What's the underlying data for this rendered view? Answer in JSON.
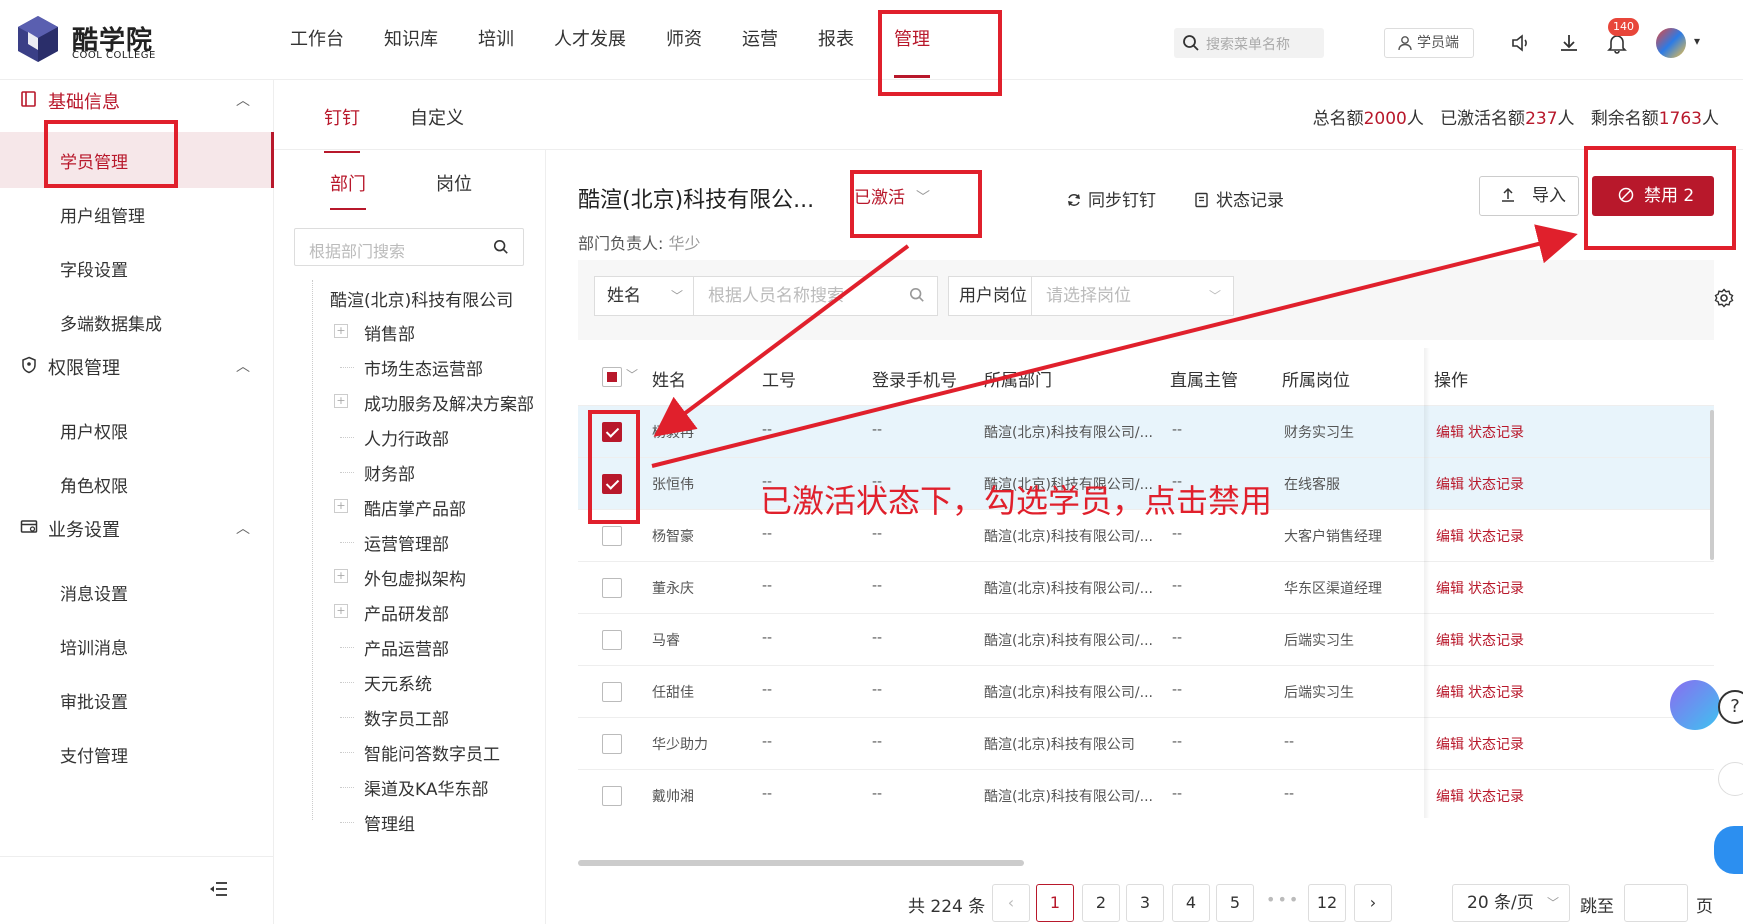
{
  "brand": {
    "name": "酷学院",
    "sub": "COOL COLLEGE"
  },
  "nav": [
    "工作台",
    "知识库",
    "培训",
    "人才发展",
    "师资",
    "运营",
    "报表",
    "管理"
  ],
  "header": {
    "search_placeholder": "搜索菜单名称",
    "student_label": "学员端",
    "notification_count": "140"
  },
  "sidebar": {
    "groups": [
      {
        "label": "基础信息",
        "items": [
          "学员管理",
          "用户组管理",
          "字段设置",
          "多端数据集成"
        ]
      },
      {
        "label": "权限管理",
        "items": [
          "用户权限",
          "角色权限"
        ]
      },
      {
        "label": "业务设置",
        "items": [
          "消息设置",
          "培训消息",
          "审批设置",
          "支付管理"
        ]
      }
    ]
  },
  "main_tabs": [
    "钉钉",
    "自定义"
  ],
  "quota": {
    "total_label": "总名额",
    "total": "2000",
    "unit": "人",
    "active_label": "已激活名额",
    "active": "237",
    "remaining_label": "剩余名额",
    "remaining": "1763"
  },
  "dept_tabs": [
    "部门",
    "岗位"
  ],
  "dept_search_placeholder": "根据部门搜索",
  "tree": {
    "root": "酷渲(北京)科技有限公司",
    "nodes": [
      {
        "label": "销售部",
        "expandable": true
      },
      {
        "label": "市场生态运营部",
        "expandable": false
      },
      {
        "label": "成功服务及解决方案部",
        "expandable": true
      },
      {
        "label": "人力行政部",
        "expandable": false
      },
      {
        "label": "财务部",
        "expandable": false
      },
      {
        "label": "酷店掌产品部",
        "expandable": true
      },
      {
        "label": "运营管理部",
        "expandable": false
      },
      {
        "label": "外包虚拟架构",
        "expandable": true
      },
      {
        "label": "产品研发部",
        "expandable": true
      },
      {
        "label": "产品运营部",
        "expandable": false
      },
      {
        "label": "天元系统",
        "expandable": false
      },
      {
        "label": "数字员工部",
        "expandable": false
      },
      {
        "label": "智能问答数字员工",
        "expandable": false
      },
      {
        "label": "渠道及KA华东部",
        "expandable": false
      },
      {
        "label": "管理组",
        "expandable": false
      }
    ]
  },
  "content": {
    "company": "酷渲(北京)科技有限公...",
    "status": "已激活",
    "dept_head_label": "部门负责人:",
    "dept_head": "华少",
    "sync_label": "同步钉钉",
    "status_log_label": "状态记录",
    "import_label": "导入",
    "ban_label": "禁用 2"
  },
  "filters": {
    "name_select": "姓名",
    "name_placeholder": "根据人员名称搜索",
    "post_label": "用户岗位",
    "post_placeholder": "请选择岗位"
  },
  "table": {
    "headers": [
      "姓名",
      "工号",
      "登录手机号",
      "所属部门",
      "直属主管",
      "所属岗位",
      "操作"
    ],
    "rows": [
      {
        "name": "杨毅冉",
        "id": "--",
        "phone": "--",
        "dept": "酷渲(北京)科技有限公司/...",
        "manager": "--",
        "post": "财务实习生",
        "checked": true
      },
      {
        "name": "张恒伟",
        "id": "--",
        "phone": "--",
        "dept": "酷渲(北京)科技有限公司/...",
        "manager": "--",
        "post": "在线客服",
        "checked": true
      },
      {
        "name": "杨智豪",
        "id": "--",
        "phone": "--",
        "dept": "酷渲(北京)科技有限公司/...",
        "manager": "--",
        "post": "大客户销售经理",
        "checked": false
      },
      {
        "name": "董永庆",
        "id": "--",
        "phone": "--",
        "dept": "酷渲(北京)科技有限公司/...",
        "manager": "--",
        "post": "华东区渠道经理",
        "checked": false
      },
      {
        "name": "马睿",
        "id": "--",
        "phone": "--",
        "dept": "酷渲(北京)科技有限公司/...",
        "manager": "--",
        "post": "后端实习生",
        "checked": false
      },
      {
        "name": "任甜佳",
        "id": "--",
        "phone": "--",
        "dept": "酷渲(北京)科技有限公司/...",
        "manager": "--",
        "post": "后端实习生",
        "checked": false
      },
      {
        "name": "华少助力",
        "id": "--",
        "phone": "--",
        "dept": "酷渲(北京)科技有限公司",
        "manager": "--",
        "post": "--",
        "checked": false
      },
      {
        "name": "戴帅湘",
        "id": "--",
        "phone": "--",
        "dept": "酷渲(北京)科技有限公司/...",
        "manager": "--",
        "post": "--",
        "checked": false
      }
    ],
    "action_edit": "编辑",
    "action_log": "状态记录"
  },
  "pager": {
    "total_text": "共 224 条",
    "pages": [
      "1",
      "2",
      "3",
      "4",
      "5"
    ],
    "last_page": "12",
    "current": "1",
    "size": "20 条/页",
    "jump_label": "跳至",
    "page_label": "页"
  },
  "annotation": {
    "text": "已激活状态下，勾选学员，点击禁用",
    "color": "#e0202c"
  },
  "colors": {
    "brand": "#b8182b",
    "selected_row": "#e8f4fb"
  }
}
